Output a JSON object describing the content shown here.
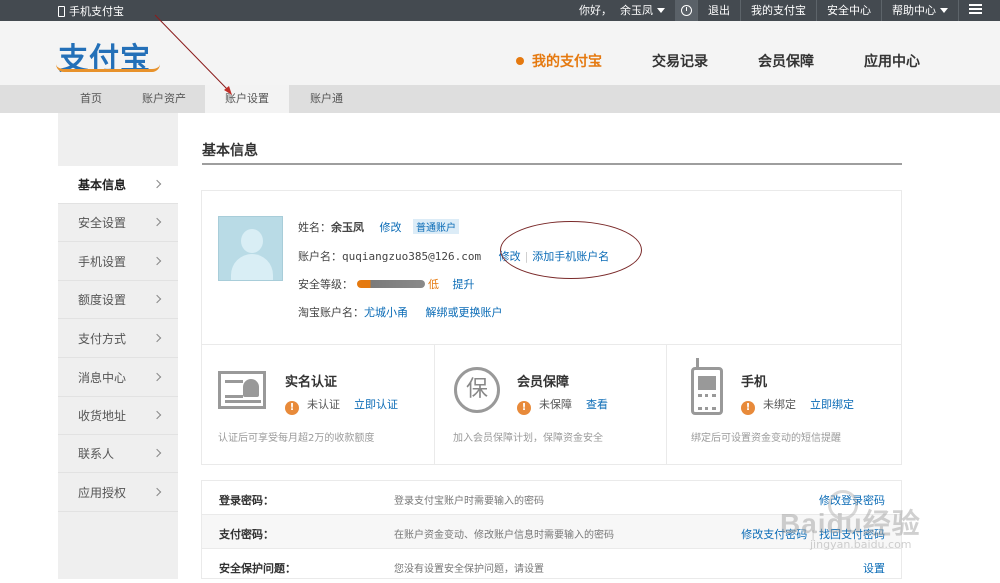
{
  "topbar": {
    "mobile_label": "手机支付宝",
    "greeting": "你好，",
    "username": "余玉凤",
    "logout": "退出",
    "my_alipay": "我的支付宝",
    "security": "安全中心",
    "help": "帮助中心"
  },
  "header": {
    "logo": "支付宝",
    "nav": [
      "我的支付宝",
      "交易记录",
      "会员保障",
      "应用中心"
    ]
  },
  "subnav": [
    "首页",
    "账户资产",
    "账户设置",
    "账户通"
  ],
  "sidebar": [
    "基本信息",
    "安全设置",
    "手机设置",
    "额度设置",
    "支付方式",
    "消息中心",
    "收货地址",
    "联系人",
    "应用授权"
  ],
  "main": {
    "title": "基本信息",
    "name_label": "姓名：",
    "name_value": "余玉凤",
    "modify": "修改",
    "account_type": "普通账户",
    "account_label": "账户名：",
    "account_value": "quqiangzuo385@126.com",
    "add_mobile": "添加手机账户名",
    "level_label": "安全等级：",
    "level_value": "低",
    "level_fraction": 0.2,
    "upgrade": "提升",
    "taobao_label": "淘宝账户名：",
    "taobao_value": "尤城小甬",
    "taobao_action": "解绑或更换账户"
  },
  "cards": [
    {
      "title": "实名认证",
      "status": "未认证",
      "action": "立即认证",
      "desc": "认证后可享受每月超2万的收款额度"
    },
    {
      "title": "会员保障",
      "status": "未保障",
      "action": "查看",
      "desc": "加入会员保障计划，保障资金安全"
    },
    {
      "title": "手机",
      "status": "未绑定",
      "action": "立即绑定",
      "desc": "绑定后可设置资金变动的短信提醒"
    }
  ],
  "rows": [
    {
      "key": "登录密码：",
      "desc": "登录支付宝账户时需要输入的密码",
      "actions": [
        "修改登录密码"
      ]
    },
    {
      "key": "支付密码：",
      "desc": "在账户资金变动、修改账户信息时需要输入的密码",
      "actions": [
        "修改支付密码",
        "找回支付密码"
      ]
    },
    {
      "key": "安全保护问题：",
      "desc": "您没有设置安全保护问题，请设置",
      "actions": [
        "设置"
      ]
    }
  ],
  "watermark": {
    "brand": "Baidu经验",
    "url": "jingyan.baidu.com"
  },
  "colors": {
    "topbar": "#444a50",
    "accent": "#e5790f",
    "link": "#0a6bb6",
    "logo": "#2470b8"
  }
}
